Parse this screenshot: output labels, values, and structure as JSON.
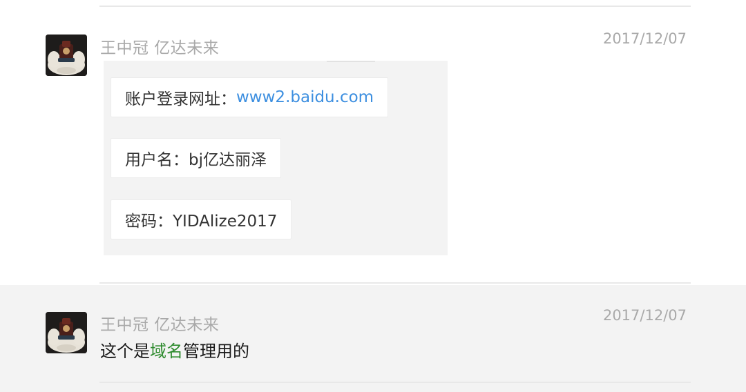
{
  "messages": [
    {
      "sender": "王中冠 亿达未来",
      "date": "2017/12/07",
      "forwarded_items": [
        {
          "label": "账户登录网址：",
          "link": "www2.baidu.com"
        },
        {
          "label": "用户名：bj亿达丽泽"
        },
        {
          "label": "密码：YIDAlize2017"
        }
      ]
    },
    {
      "sender": "王中冠 亿达未来",
      "date": "2017/12/07",
      "text_before": "这个是",
      "text_highlight": "域名",
      "text_after": "管理用的"
    }
  ],
  "colors": {
    "link": "#3d8fe0",
    "highlight": "#2e8b2e",
    "meta_text": "#a9a9a9"
  },
  "icons": [
    "avatar-image"
  ]
}
